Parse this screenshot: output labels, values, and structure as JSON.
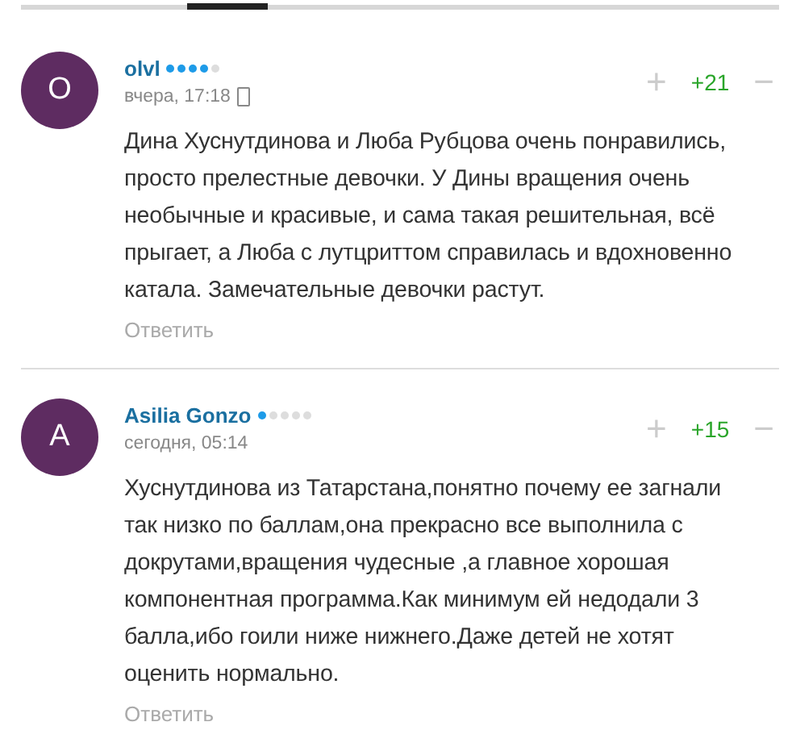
{
  "comments": [
    {
      "avatar_letter": "O",
      "author": "olvl",
      "stars": 4,
      "time": "вчера, 17:18",
      "mobile": true,
      "plus": "+",
      "rating": "+21",
      "minus": "−",
      "text": "Дина Хуснутдинова и Люба Рубцова очень понравились, просто прелестные девочки. У Дины вращения очень необычные и красивые, и сама такая решительная, всё прыгает, а Люба с лутцриттом справилась и вдохновенно катала. Замечательные девочки растут.",
      "reply": "Ответить"
    },
    {
      "avatar_letter": "A",
      "author": "Asilia Gonzo",
      "stars": 1,
      "time": "сегодня, 05:14",
      "mobile": false,
      "plus": "+",
      "rating": "+15",
      "minus": "−",
      "text": "Хуснутдинова из Татарстана,понятно почему ее загнали так низко по баллам,она прекрасно все выполнила с докрутами,вращения чудесные ,а главное хорошая компонентная программа.Как минимум ей недодали 3 балла,ибо гоили ниже нижнего.Даже детей не хотят оценить нормально.",
      "reply": "Ответить"
    }
  ]
}
